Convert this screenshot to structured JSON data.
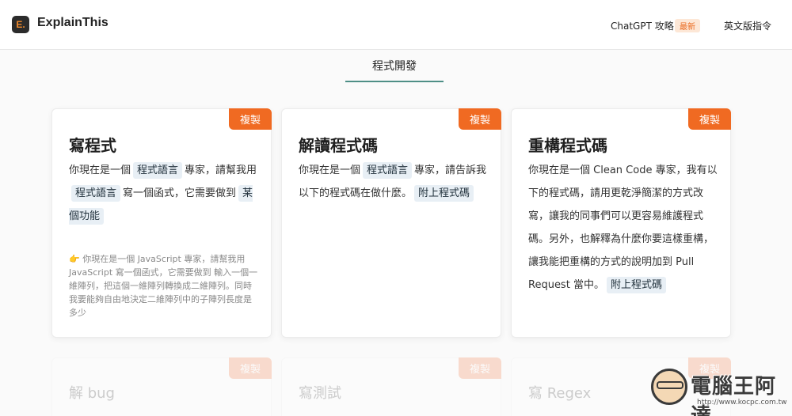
{
  "header": {
    "logo_letter": "E.",
    "brand": "ExplainThis",
    "nav_chatgpt": "ChatGPT 攻略",
    "badge_new": "最新",
    "nav_english": "英文版指令"
  },
  "tab": {
    "label": "程式開發"
  },
  "cards": [
    {
      "copy": "複製",
      "title": "寫程式",
      "body": [
        {
          "t": "你現在是一個"
        },
        {
          "chip": "程式語言"
        },
        {
          "t": "專家，請幫我用"
        },
        {
          "chip": "程式語言"
        },
        {
          "t": "寫一個函式，它需要做到"
        },
        {
          "chip": "某個功能"
        }
      ],
      "example": "👉 你現在是一個 JavaScript 專家，請幫我用 JavaScript 寫一個函式，它需要做到 輸入一個一維陣列，把這個一維陣列轉換成二維陣列。同時我要能夠自由地決定二維陣列中的子陣列長度是多少"
    },
    {
      "copy": "複製",
      "title": "解讀程式碼",
      "body": [
        {
          "t": "你現在是一個"
        },
        {
          "chip": "程式語言"
        },
        {
          "t": "專家，請告訴我以下的程式碼在做什麼。"
        },
        {
          "chip": "附上程式碼"
        }
      ]
    },
    {
      "copy": "複製",
      "title": "重構程式碼",
      "body": [
        {
          "t": "你現在是一個 Clean Code 專家，我有以下的程式碼，請用更乾淨簡潔的方式改寫，讓我的同事們可以更容易維護程式碼。另外，也解釋為什麼你要這樣重構，讓我能把重構的方式的說明加到 Pull Request 當中。"
        },
        {
          "chip": "附上程式碼"
        }
      ]
    }
  ],
  "ghost_cards": [
    {
      "copy": "複製",
      "title": "解 bug"
    },
    {
      "copy": "複製",
      "title": "寫測試"
    },
    {
      "copy": "複製",
      "title": "寫 Regex"
    }
  ],
  "watermark": {
    "text": "電腦王阿達",
    "url": "http://www.kocpc.com.tw"
  }
}
